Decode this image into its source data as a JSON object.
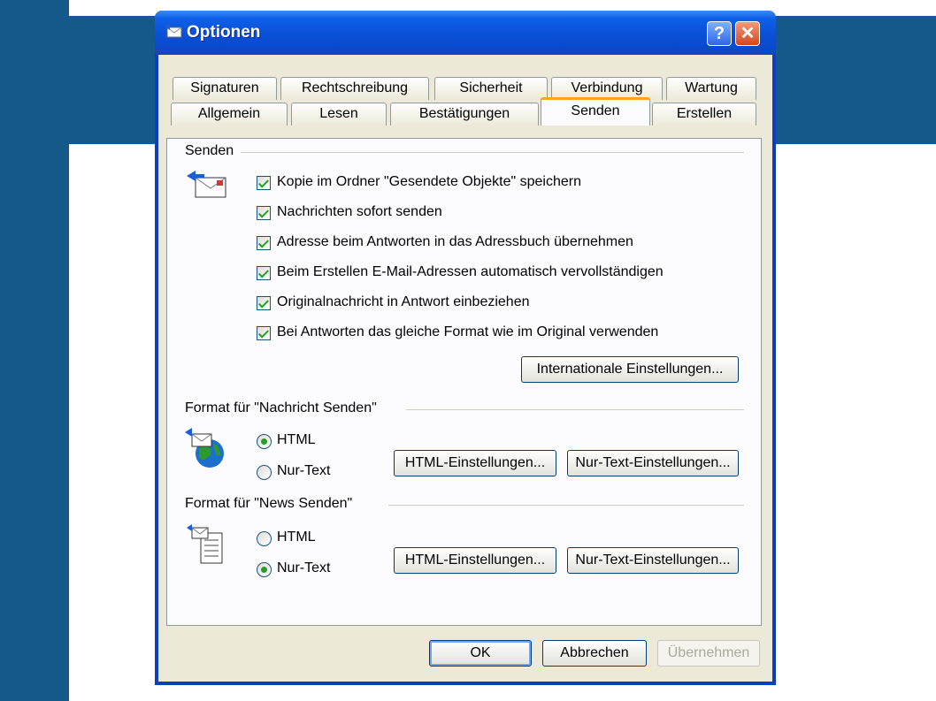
{
  "window": {
    "title": "Optionen",
    "help_glyph": "?",
    "close_glyph": "✕"
  },
  "tabs_row1": [
    "Signaturen",
    "Rechtschreibung",
    "Sicherheit",
    "Verbindung",
    "Wartung"
  ],
  "tabs_row2": [
    "Allgemein",
    "Lesen",
    "Bestätigungen",
    "Senden",
    "Erstellen"
  ],
  "active_tab": "Senden",
  "send_group": {
    "label": "Senden",
    "checkboxes": [
      {
        "label": "Kopie im Ordner \"Gesendete Objekte\" speichern",
        "checked": true
      },
      {
        "label": "Nachrichten sofort senden",
        "checked": true
      },
      {
        "label": "Adresse beim Antworten in das Adressbuch übernehmen",
        "checked": true
      },
      {
        "label": "Beim Erstellen E-Mail-Adressen automatisch vervollständigen",
        "checked": true
      },
      {
        "label": "Originalnachricht in Antwort einbeziehen",
        "checked": true
      },
      {
        "label": "Bei Antworten das gleiche Format wie im Original verwenden",
        "checked": true
      }
    ],
    "intl_button": "Internationale Einstellungen..."
  },
  "mail_format": {
    "label": "Format für \"Nachricht Senden\"",
    "options": [
      "HTML",
      "Nur-Text"
    ],
    "selected": "HTML",
    "html_button": "HTML-Einstellungen...",
    "text_button": "Nur-Text-Einstellungen..."
  },
  "news_format": {
    "label": "Format für \"News Senden\"",
    "options": [
      "HTML",
      "Nur-Text"
    ],
    "selected": "Nur-Text",
    "html_button": "HTML-Einstellungen...",
    "text_button": "Nur-Text-Einstellungen..."
  },
  "footer": {
    "ok": "OK",
    "cancel": "Abbrechen",
    "apply": "Übernehmen"
  },
  "colors": {
    "background_blue": "#14598a",
    "titlebar_blue": "#0a4ed6",
    "dialog_face": "#ece9d8",
    "check_green": "#21a121"
  },
  "icons": [
    "mail-window-icon",
    "outbox-envelope-icon",
    "globe-mail-icon",
    "news-document-icon"
  ]
}
